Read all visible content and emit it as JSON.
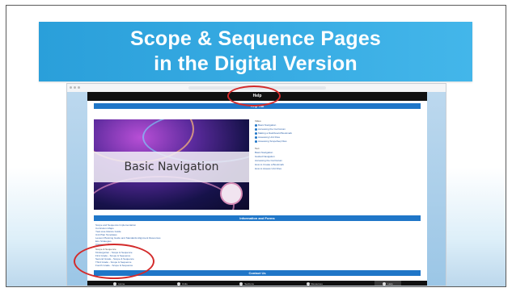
{
  "slide": {
    "title_line1": "Scope & Sequence Pages",
    "title_line2": "in the Digital Version",
    "accent_color": "#2a9fda",
    "annotation_color": "#d32a2a"
  },
  "screenshot": {
    "top_bar_label": "Help",
    "header_primary": "Help Tab",
    "hero_text": "Basic Navigation",
    "help_groups": [
      {
        "heading": "Video",
        "items": [
          "Basic Navigation",
          "Accessing the Curriculum",
          "Making a Dashboard Bookmark",
          "Assessing Unit Files",
          "Assessing ScopeSeq Files"
        ]
      },
      {
        "heading": "Text",
        "items": [
          "Basic Navigation",
          "Guided Navigation",
          "Accessing the Curriculum",
          "How to Create a Bookmark",
          "How to Assess Unit Files"
        ]
      }
    ],
    "section_info": "Information and Forms",
    "info_items": [
      "Scope and Sequence Implementation",
      "Curriculum Maps",
      "Year-at-a-Glance Guide",
      "Unit Plan Templates",
      "Lesson Planning Guide and Standards Alignment Resources",
      "ELL Strategies",
      "Classroom Resources"
    ],
    "resources_heading": "Scope & Sequence",
    "resources_items": [
      "Kindergarten - Scope & Sequence",
      "First Grade - Scope & Sequence",
      "Second Grade - Scope & Sequence",
      "Third Grade - Scope & Sequence",
      "Fourth Grade - Scope & Sequence"
    ],
    "section_contact": "Contact Us",
    "bottom_nav": [
      {
        "label": "Home",
        "icon": "home-icon"
      },
      {
        "label": "Units",
        "icon": "book-icon"
      },
      {
        "label": "Sections",
        "icon": "list-icon"
      },
      {
        "label": "Resources",
        "icon": "folder-icon"
      },
      {
        "label": "Help",
        "icon": "help-icon"
      }
    ]
  }
}
